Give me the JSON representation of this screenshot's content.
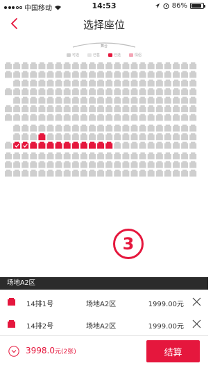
{
  "status_bar": {
    "carrier": "中国移动",
    "time": "14:53",
    "battery": "86%",
    "battery_level": 0.86
  },
  "nav": {
    "title": "选择座位"
  },
  "screen": {
    "label": "舞台"
  },
  "legend": [
    {
      "label": "可选",
      "icon": "seat-available-icon"
    },
    {
      "label": "已售",
      "icon": "seat-sold-icon"
    },
    {
      "label": "已选",
      "icon": "seat-selected-icon"
    },
    {
      "label": "情侣",
      "icon": "seat-couple-icon"
    }
  ],
  "colors": {
    "accent": "#e5173d",
    "seat_available": "#cfcfcf",
    "header_bar": "#2b2b2b"
  },
  "seatmap": {
    "columns": 23,
    "rows": [
      {
        "type": "normal"
      },
      {
        "type": "normal"
      },
      {
        "type": "normal"
      },
      {
        "type": "normal"
      },
      {
        "type": "normal"
      },
      {
        "type": "normal"
      },
      {
        "type": "normal"
      },
      {
        "type": "normal"
      },
      {
        "type": "partial-red",
        "red_cols": [
          4
        ]
      },
      {
        "type": "red-left",
        "red_cols": [
          1,
          2,
          3,
          4,
          5,
          6,
          7,
          8,
          9,
          10,
          11,
          12
        ],
        "checked_cols": [
          1,
          2
        ]
      },
      {
        "type": "normal"
      },
      {
        "type": "normal"
      },
      {
        "type": "normal"
      }
    ]
  },
  "annotation_number": "③",
  "selection": {
    "zone_header": "场地A2区",
    "tickets": [
      {
        "row_seat": "14排1号",
        "zone": "场地A2区",
        "price": "1999.00元"
      },
      {
        "row_seat": "14排2号",
        "zone": "场地A2区",
        "price": "1999.00元"
      }
    ]
  },
  "bottom": {
    "total": "3998.0",
    "unit": "元",
    "count": "(2张)",
    "pay_label": "结算"
  }
}
